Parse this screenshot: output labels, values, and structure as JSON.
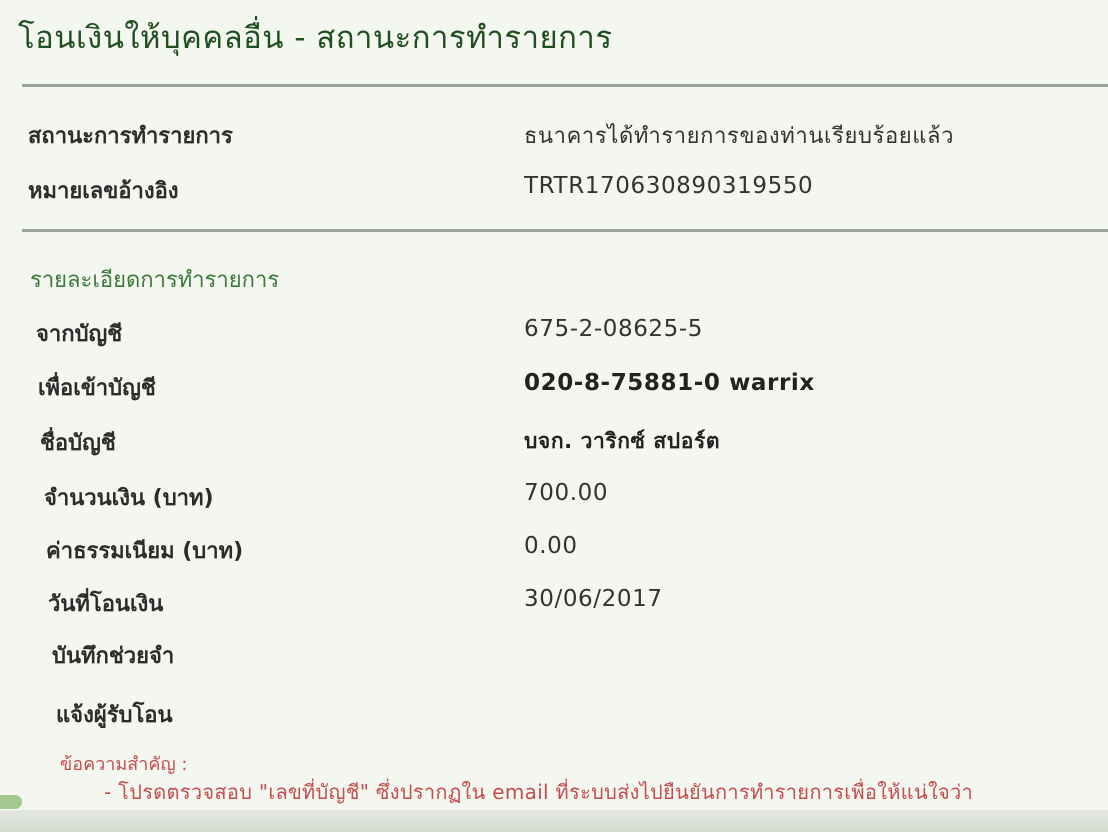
{
  "page_title": "โอนเงินให้บุคคลอื่น - สถานะการทำรายการ",
  "status_section": {
    "status_label": "สถานะการทำรายการ",
    "status_value": "ธนาคารได้ทำรายการของท่านเรียบร้อยแล้ว",
    "reference_label": "หมายเลขอ้างอิง",
    "reference_value": "TRTR170630890319550"
  },
  "details": {
    "heading": "รายละเอียดการทำรายการ",
    "from_account_label": "จากบัญชี",
    "from_account_value": "675-2-08625-5",
    "to_account_label": "เพื่อเข้าบัญชี",
    "to_account_value": "020-8-75881-0 warrix",
    "account_name_label": "ชื่อบัญชี",
    "account_name_value": "บจก. วาริกซ์ สปอร์ต",
    "amount_label": "จำนวนเงิน (บาท)",
    "amount_value": "700.00",
    "fee_label": "ค่าธรรมเนียม (บาท)",
    "fee_value": "0.00",
    "transfer_date_label": "วันที่โอนเงิน",
    "transfer_date_value": "30/06/2017",
    "memo_label": "บันทึกช่วยจำ",
    "memo_value": "",
    "notify_recipient_label": "แจ้งผู้รับโอน",
    "notify_recipient_value": ""
  },
  "important_note": {
    "title": "ข้อความสำคัญ :",
    "line": "- โปรดตรวจสอบ \"เลขที่บัญชี\" ซึ่งปรากฏใน email ที่ระบบส่งไปยืนยันการทำรายการเพื่อให้แน่ใจว่า"
  },
  "colors": {
    "title": "#1f4f1f",
    "heading": "#3c7a3c",
    "note": "#c44d4d"
  }
}
